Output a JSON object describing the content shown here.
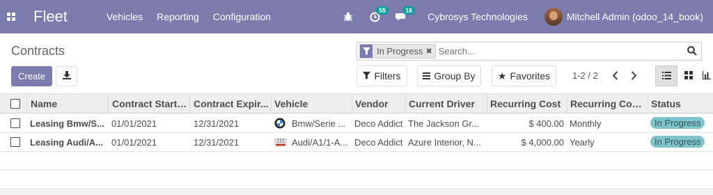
{
  "navbar": {
    "app_name": "Fleet",
    "menu": [
      "Vehicles",
      "Reporting",
      "Configuration"
    ],
    "activity_count": "55",
    "message_count": "16",
    "company": "Cybrosys Technologies",
    "user": "Mitchell Admin (odoo_14_book)",
    "bg_color": "#7c7bad"
  },
  "control": {
    "breadcrumb": "Contracts",
    "facet_value": "In Progress",
    "search_placeholder": "Search...",
    "create_label": "Create",
    "filters_label": "Filters",
    "groupby_label": "Group By",
    "favorites_label": "Favorites",
    "pager": "1-2 / 2"
  },
  "table": {
    "columns": [
      "Name",
      "Contract Start ...",
      "Contract Expir...",
      "Vehicle",
      "Vendor",
      "Current Driver",
      "Recurring Cost",
      "Recurring Cost...",
      "Status"
    ],
    "rows": [
      {
        "name": "Leasing Bmw/S...",
        "start": "01/01/2021",
        "expiry": "12/31/2021",
        "vehicle": "Bmw/Serie ...",
        "vehicle_icon": "bmw-logo-icon",
        "vendor": "Deco Addict",
        "driver": "The Jackson Gr...",
        "cost": "$ 400.00",
        "frequency": "Monthly",
        "status": "In Progress"
      },
      {
        "name": "Leasing Audi/A...",
        "start": "01/01/2021",
        "expiry": "12/31/2021",
        "vehicle": "Audi/A1/1-A...",
        "vehicle_icon": "audi-logo-icon",
        "vendor": "Deco Addict",
        "driver": "Azure Interior, N...",
        "cost": "$ 4,000.00",
        "frequency": "Yearly",
        "status": "In Progress"
      }
    ],
    "status_color": "#7fc4ca"
  }
}
